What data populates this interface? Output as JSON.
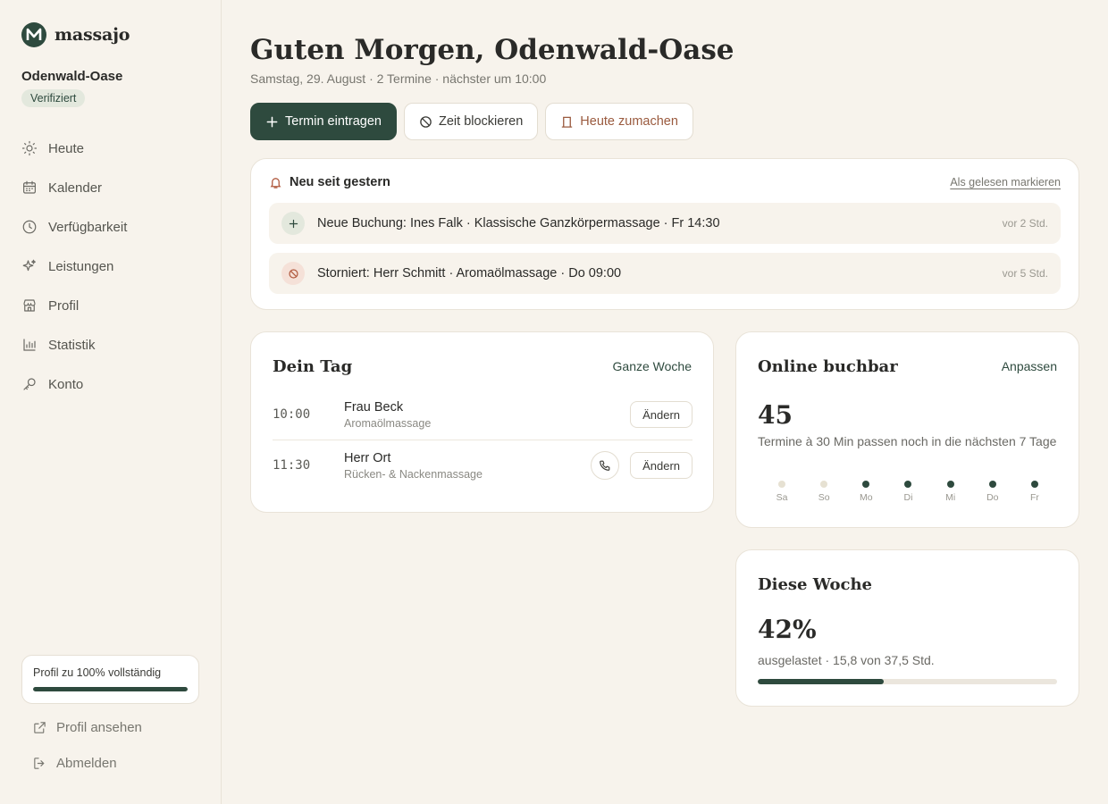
{
  "brand": {
    "name": "massajo",
    "logo_letter": "M"
  },
  "studio": {
    "name": "Odenwald-Oase",
    "badge": "Verifiziert"
  },
  "nav": {
    "items": [
      {
        "label": "Heute",
        "icon": "sun-icon"
      },
      {
        "label": "Kalender",
        "icon": "calendar-icon"
      },
      {
        "label": "Verfügbarkeit",
        "icon": "clock-icon"
      },
      {
        "label": "Leistungen",
        "icon": "sparkle-icon"
      },
      {
        "label": "Profil",
        "icon": "storefront-icon"
      },
      {
        "label": "Statistik",
        "icon": "bar-chart-icon"
      },
      {
        "label": "Konto",
        "icon": "key-icon"
      }
    ]
  },
  "profile_completion": {
    "label": "Profil zu 100% vollständig",
    "percent": 100
  },
  "footer": {
    "view_profile": "Profil ansehen",
    "logout": "Abmelden"
  },
  "header": {
    "greeting": "Guten Morgen, Odenwald-Oase",
    "subline": "Samstag, 29. August · 2 Termine · nächster um 10:00"
  },
  "actions": {
    "add": "Termin eintragen",
    "block": "Zeit blockieren",
    "close_today": "Heute zumachen"
  },
  "notifications": {
    "title": "Neu seit gestern",
    "mark_read": "Als gelesen markieren",
    "items": [
      {
        "text": "Neue Buchung: Ines Falk · Klassische Ganzkörpermassage · Fr 14:30",
        "time": "vor 2 Std.",
        "type": "booking"
      },
      {
        "text": "Storniert: Herr Schmitt · Aromaölmassage · Do 09:00",
        "time": "vor 5 Std.",
        "type": "cancel"
      }
    ]
  },
  "day": {
    "title": "Dein Tag",
    "link": "Ganze Woche",
    "appointments": [
      {
        "time": "10:00",
        "name": "Frau Beck",
        "service": "Aromaölmassage",
        "action": "Ändern",
        "phone": false
      },
      {
        "time": "11:30",
        "name": "Herr Ort",
        "service": "Rücken- & Nackenmassage",
        "action": "Ändern",
        "phone": true
      }
    ]
  },
  "online": {
    "title": "Online buchbar",
    "link": "Anpassen",
    "value": "45",
    "description": "Termine à 30 Min passen noch in die nächsten 7 Tage",
    "days": [
      {
        "label": "Sa",
        "available": false
      },
      {
        "label": "So",
        "available": false
      },
      {
        "label": "Mo",
        "available": true
      },
      {
        "label": "Di",
        "available": true
      },
      {
        "label": "Mi",
        "available": true
      },
      {
        "label": "Do",
        "available": true
      },
      {
        "label": "Fr",
        "available": true
      }
    ]
  },
  "week": {
    "title": "Diese Woche",
    "value": "42%",
    "description": "ausgelastet · 15,8 von 37,5 Std.",
    "utilization": 42
  },
  "colors": {
    "accent": "#2e4a3e",
    "background": "#f7f3ec",
    "warn": "#9a5a3e",
    "dot_inactive": "#e6e1d2"
  }
}
